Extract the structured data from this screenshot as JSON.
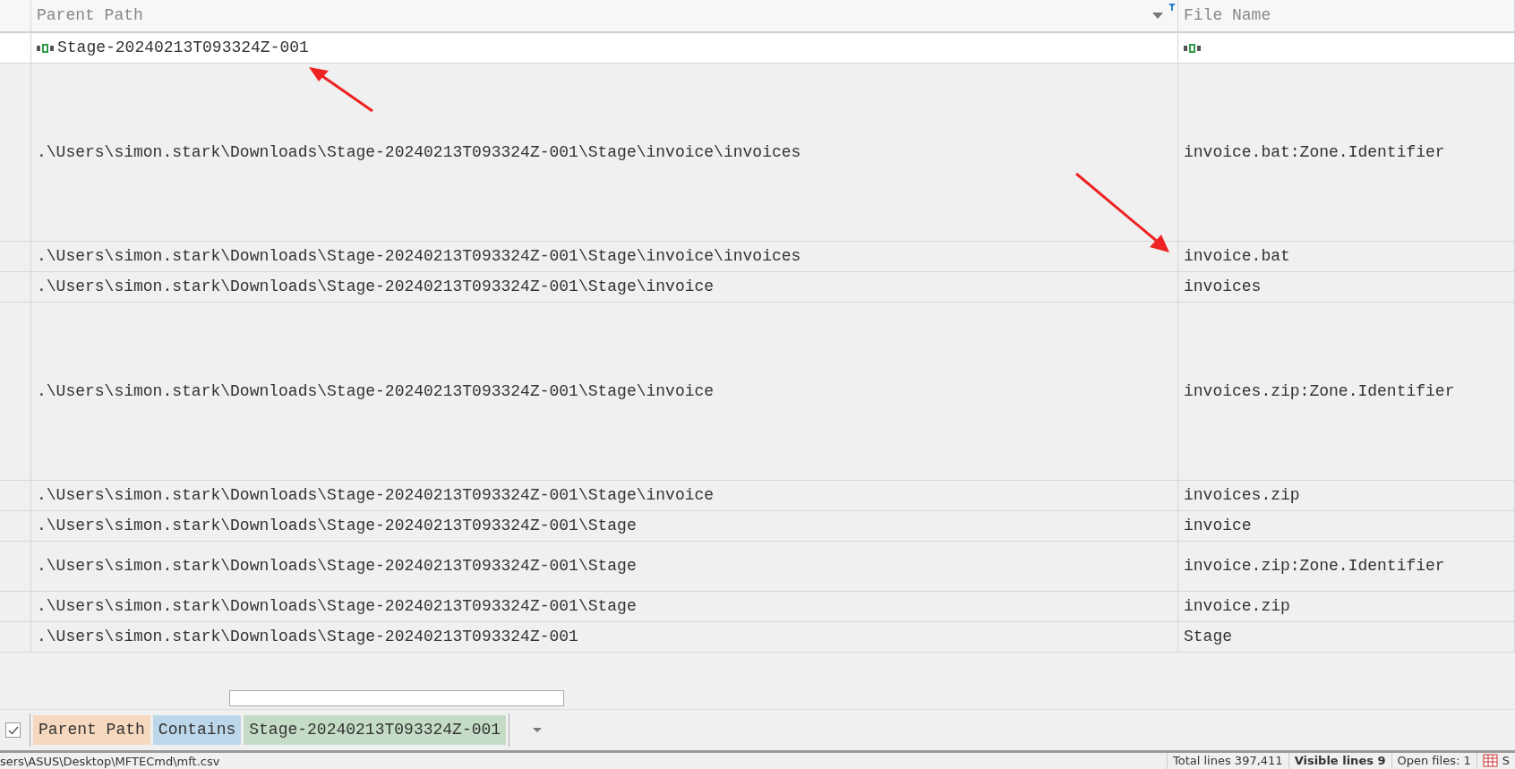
{
  "table": {
    "columns": [
      {
        "label": "Parent Path",
        "dropdown": true,
        "filtered": true
      },
      {
        "label": "File Name",
        "dropdown": false,
        "filtered": false
      }
    ],
    "filter_value": "Stage-20240213T093324Z-001",
    "rows": [
      {
        "kind": "tall",
        "cells": [
          ".\\Users\\simon.stark\\Downloads\\Stage-20240213T093324Z-001\\Stage\\invoice\\invoices",
          "invoice.bat:Zone.Identifier"
        ]
      },
      {
        "kind": "normal",
        "cells": [
          ".\\Users\\simon.stark\\Downloads\\Stage-20240213T093324Z-001\\Stage\\invoice\\invoices",
          "invoice.bat"
        ]
      },
      {
        "kind": "normal",
        "cells": [
          ".\\Users\\simon.stark\\Downloads\\Stage-20240213T093324Z-001\\Stage\\invoice",
          "invoices"
        ]
      },
      {
        "kind": "tall",
        "cells": [
          ".\\Users\\simon.stark\\Downloads\\Stage-20240213T093324Z-001\\Stage\\invoice",
          "invoices.zip:Zone.Identifier"
        ]
      },
      {
        "kind": "normal",
        "cells": [
          ".\\Users\\simon.stark\\Downloads\\Stage-20240213T093324Z-001\\Stage\\invoice",
          "invoices.zip"
        ]
      },
      {
        "kind": "normal",
        "cells": [
          ".\\Users\\simon.stark\\Downloads\\Stage-20240213T093324Z-001\\Stage",
          "invoice"
        ]
      },
      {
        "kind": "medium",
        "cells": [
          ".\\Users\\simon.stark\\Downloads\\Stage-20240213T093324Z-001\\Stage",
          "invoice.zip:Zone.Identifier"
        ]
      },
      {
        "kind": "normal",
        "cells": [
          ".\\Users\\simon.stark\\Downloads\\Stage-20240213T093324Z-001\\Stage",
          "invoice.zip"
        ]
      },
      {
        "kind": "normal",
        "cells": [
          ".\\Users\\simon.stark\\Downloads\\Stage-20240213T093324Z-001",
          "Stage"
        ]
      }
    ]
  },
  "filter_bar": {
    "checked": true,
    "field": "Parent Path",
    "operator": "Contains",
    "value": "Stage-20240213T093324Z-001"
  },
  "status_bar": {
    "path": "sers\\ASUS\\Desktop\\MFTECmd\\mft.csv",
    "total": "Total lines 397,411",
    "visible": "Visible lines 9",
    "open_files": "Open files: 1",
    "extra": "S"
  }
}
